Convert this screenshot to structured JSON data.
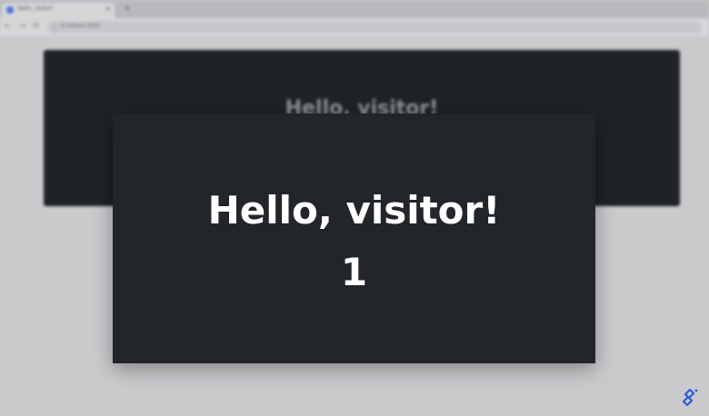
{
  "browser": {
    "tab_title": "Hello, visitor!",
    "tab_close": "×",
    "new_tab": "+",
    "nav_back": "←",
    "nav_forward": "→",
    "nav_reload": "⟳",
    "url": "localhost:3000"
  },
  "background_card": {
    "title": "Hello, visitor!"
  },
  "card": {
    "title": "Hello, visitor!",
    "count": "1"
  },
  "colors": {
    "card_background": "#222529",
    "card_text": "#ffffff",
    "page_background": "#c9c9cc",
    "logo_accent": "#2f5bd6"
  },
  "icons": {
    "brand_logo": "toptal-logo-icon"
  }
}
